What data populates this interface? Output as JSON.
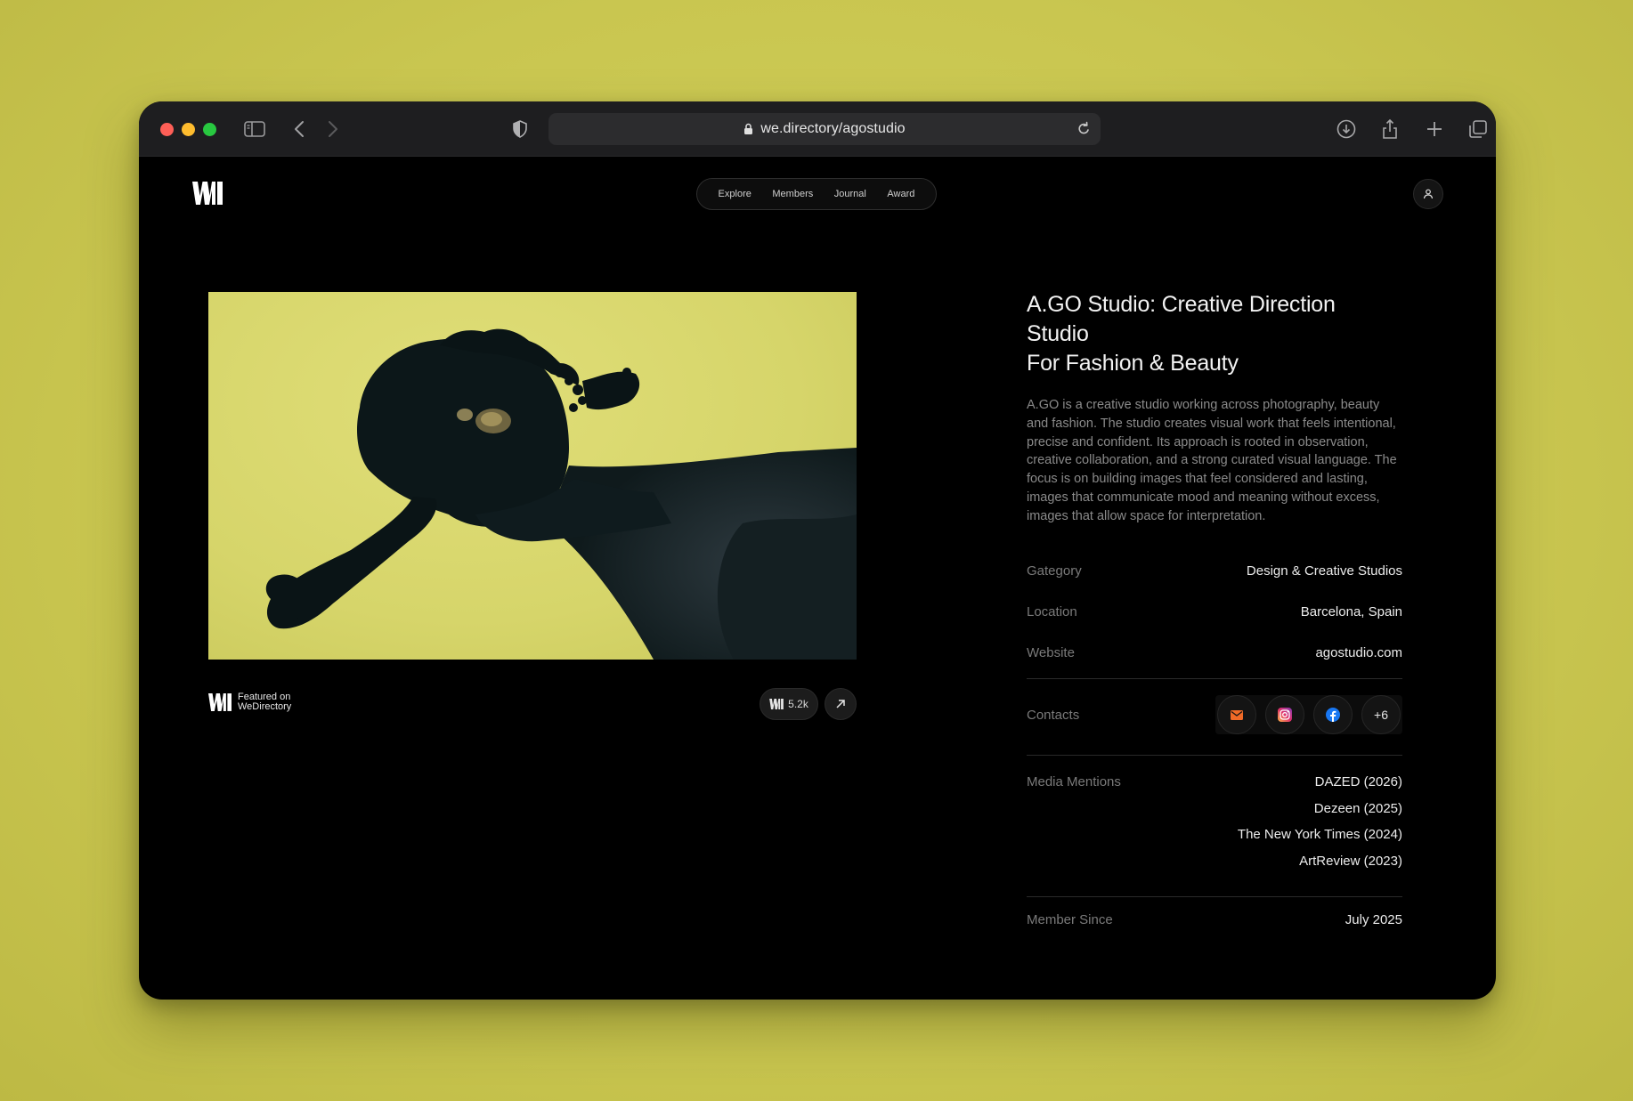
{
  "browser": {
    "url": "we.directory/agostudio"
  },
  "nav": {
    "items": [
      "Explore",
      "Members",
      "Journal",
      "Award"
    ]
  },
  "hero": {
    "featured_line1": "Featured on",
    "featured_line2": "WeDirectory",
    "likes": "5.2k"
  },
  "profile": {
    "title_line1": "A.GO Studio: Creative Direction Studio",
    "title_line2": "For Fashion & Beauty",
    "description": "A.GO is a creative studio working across photography, beauty and fashion. The studio creates visual work that feels intentional, precise and confident. Its approach is rooted in observation, creative collaboration, and a strong curated visual language. The focus is on building images that feel considered and lasting, images that communicate mood and meaning without excess, images that allow space for interpretation.",
    "category_label": "Gategory",
    "category_value": "Design & Creative Studios",
    "location_label": "Location",
    "location_value": "Barcelona, Spain",
    "website_label": "Website",
    "website_value": "agostudio.com",
    "contacts_label": "Contacts",
    "contacts_more": "+6",
    "media_label": "Media Mentions",
    "media": [
      "DAZED (2026)",
      "Dezeen (2025)",
      "The New York Times (2024)",
      "ArtReview (2023)"
    ],
    "member_label": "Member Since",
    "member_value": "July 2025"
  },
  "colors": {
    "background": "#cfcd57",
    "window": "#000000",
    "chrome": "#1e1e20",
    "mail_accent": "#f06a27"
  }
}
